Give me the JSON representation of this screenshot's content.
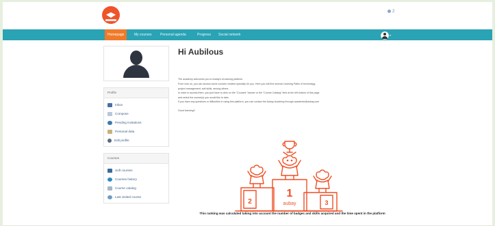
{
  "header": {
    "user_badge": "2"
  },
  "nav": {
    "items": [
      {
        "label": "Homepage",
        "active": true
      },
      {
        "label": "My courses",
        "active": false
      },
      {
        "label": "Personal agenda",
        "active": false
      },
      {
        "label": "Progress",
        "active": false
      },
      {
        "label": "Social network",
        "active": false
      }
    ],
    "colors": {
      "bar": "#2aa3b4",
      "active": "#f07a2a"
    }
  },
  "sidebar": {
    "profile": {
      "title": "Profile",
      "items": [
        {
          "label": "Inbox",
          "icon": "inbox-icon"
        },
        {
          "label": "Compose",
          "icon": "compose-icon"
        },
        {
          "label": "Pending invitations",
          "icon": "pending-invitations-icon"
        },
        {
          "label": "Personal data",
          "icon": "personal-data-icon"
        },
        {
          "label": "Edit profile",
          "icon": "edit-profile-icon"
        }
      ]
    },
    "courses": {
      "title": "Courses",
      "items": [
        {
          "label": "Soft courses",
          "icon": "soft-courses-icon"
        },
        {
          "label": "Courses history",
          "icon": "courses-history-icon"
        },
        {
          "label": "Course catalog",
          "icon": "course-catalog-icon"
        },
        {
          "label": "Last visited course",
          "icon": "last-visited-course-icon"
        }
      ]
    }
  },
  "main": {
    "greeting": "Hi Aubilous",
    "p1_lines": [
      "The academy welcomes you to Aubay's eLearning platform.",
      "From now on, you can access some courses created specially for you. Here you will find several Learning Paths of technology,",
      "project management, soft skills, among others.",
      "In order to access them, you just have to click on the \"Courses\" banner or the \"Course Catalog\" field at the left bottom of this page",
      "and select the course(s) you would like to take."
    ],
    "p2": "If you have any questions or difficulties in using this platform, you can contact the Aubay Academy through academie@aubay.com",
    "p3": "Good learning!!",
    "podium": {
      "first": "1",
      "second": "2",
      "third": "3",
      "brand": "aubay",
      "color": "#f04e23"
    },
    "caption": "This ranking was calculated taking into account the number of badges and skills acquired and the time spent in the platform"
  }
}
